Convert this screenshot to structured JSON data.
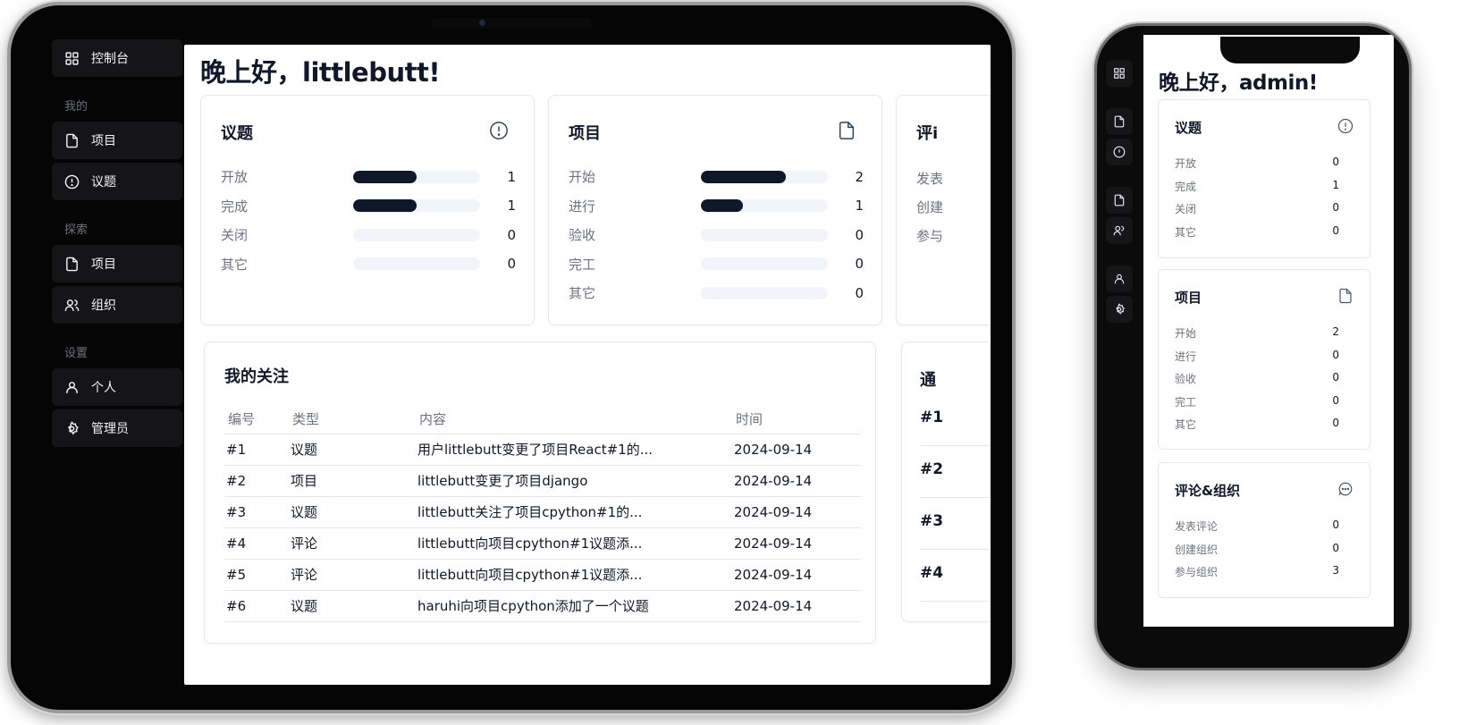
{
  "tablet": {
    "sidebar": {
      "dashboard": "控制台",
      "group_mine": "我的",
      "mine_items": [
        "项目",
        "议题"
      ],
      "group_explore": "探索",
      "explore_items": [
        "项目",
        "组织"
      ],
      "group_settings": "设置",
      "settings_items": [
        "个人",
        "管理员"
      ]
    },
    "greeting": "晚上好，littlebutt!",
    "issues_card": {
      "title": "议题",
      "rows": [
        {
          "label": "开放",
          "value": "1",
          "progress": 0.5
        },
        {
          "label": "完成",
          "value": "1",
          "progress": 0.5
        },
        {
          "label": "关闭",
          "value": "0",
          "progress": 0
        },
        {
          "label": "其它",
          "value": "0",
          "progress": 0
        }
      ]
    },
    "projects_card": {
      "title": "项目",
      "rows": [
        {
          "label": "开始",
          "value": "2",
          "progress": 0.67
        },
        {
          "label": "进行",
          "value": "1",
          "progress": 0.33
        },
        {
          "label": "验收",
          "value": "0",
          "progress": 0
        },
        {
          "label": "完工",
          "value": "0",
          "progress": 0
        },
        {
          "label": "其它",
          "value": "0",
          "progress": 0
        }
      ]
    },
    "comments_card": {
      "title_partial": "评i",
      "rows_partial": [
        "发表",
        "创建",
        "参与"
      ]
    },
    "follow_card": {
      "title": "我的关注",
      "columns": [
        "编号",
        "类型",
        "内容",
        "时间"
      ],
      "rows": [
        {
          "id": "#1",
          "type": "议题",
          "content": "用户littlebutt变更了项目React#1的...",
          "time": "2024-09-14"
        },
        {
          "id": "#2",
          "type": "项目",
          "content": "littlebutt变更了项目django",
          "time": "2024-09-14"
        },
        {
          "id": "#3",
          "type": "议题",
          "content": "littlebutt关注了项目cpython#1的...",
          "time": "2024-09-14"
        },
        {
          "id": "#4",
          "type": "评论",
          "content": "littlebutt向项目cpython#1议题添...",
          "time": "2024-09-14"
        },
        {
          "id": "#5",
          "type": "评论",
          "content": "littlebutt向项目cpython#1议题添...",
          "time": "2024-09-14"
        },
        {
          "id": "#6",
          "type": "议题",
          "content": "haruhi向项目cpython添加了一个议题",
          "time": "2024-09-14"
        }
      ]
    },
    "notify_card": {
      "title_partial": "通",
      "items_partial": [
        "#1",
        "#2",
        "#3",
        "#4"
      ]
    }
  },
  "phone": {
    "greeting": "晚上好，admin!",
    "issues_card": {
      "title": "议题",
      "rows": [
        {
          "label": "开放",
          "value": "0"
        },
        {
          "label": "完成",
          "value": "1"
        },
        {
          "label": "关闭",
          "value": "0"
        },
        {
          "label": "其它",
          "value": "0"
        }
      ]
    },
    "projects_card": {
      "title": "项目",
      "rows": [
        {
          "label": "开始",
          "value": "2"
        },
        {
          "label": "进行",
          "value": "0"
        },
        {
          "label": "验收",
          "value": "0"
        },
        {
          "label": "完工",
          "value": "0"
        },
        {
          "label": "其它",
          "value": "0"
        }
      ]
    },
    "comments_card": {
      "title": "评论&组织",
      "rows": [
        {
          "label": "发表评论",
          "value": "0"
        },
        {
          "label": "创建组织",
          "value": "0"
        },
        {
          "label": "参与组织",
          "value": "3"
        }
      ]
    }
  }
}
